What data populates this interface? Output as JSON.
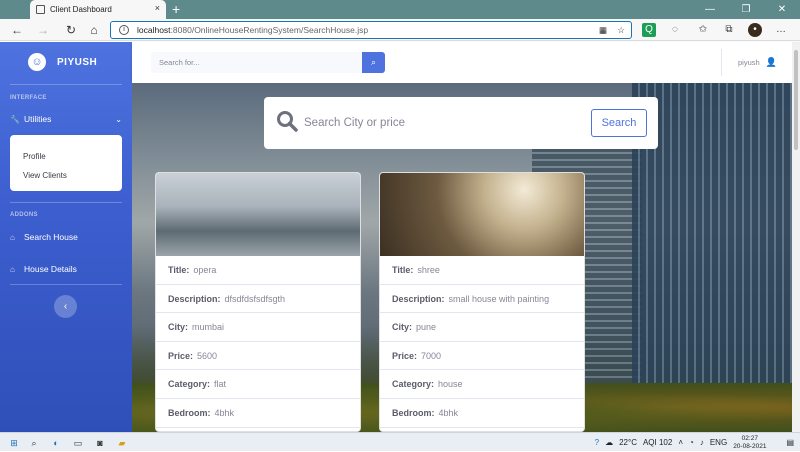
{
  "browser": {
    "tab_title": "Client Dashboard",
    "tab_close": "×",
    "new_tab": "+",
    "url_host": "localhost",
    "url_path": ":8080/OnlineHouseRentingSystem/SearchHouse.jsp",
    "win_minimize": "—",
    "win_restore": "❐",
    "win_close": "✕"
  },
  "sidebar": {
    "brand": "PIYUSH",
    "interface_heading": "INTERFACE",
    "utilities_label": "Utilities",
    "submenu": [
      "Profile",
      "View Clients"
    ],
    "addons_heading": "ADDONS",
    "search_house_label": "Search House",
    "house_details_label": "House Details",
    "toggle_glyph": "‹"
  },
  "topbar": {
    "search_placeholder": "Search for...",
    "user_name": "piyush"
  },
  "search": {
    "placeholder": "Search City or price",
    "button_label": "Search"
  },
  "cards": [
    {
      "title_label": "Title:",
      "title": "opera",
      "description_label": "Description:",
      "description": "dfsdfdsfsdfsgth",
      "city_label": "City:",
      "city": "mumbai",
      "price_label": "Price:",
      "price": "5600",
      "category_label": "Category:",
      "category": "flat",
      "bedroom_label": "Bedroom:",
      "bedroom": "4bhk"
    },
    {
      "title_label": "Title:",
      "title": "shree",
      "description_label": "Description:",
      "description": "small house with painting",
      "city_label": "City:",
      "city": "pune",
      "price_label": "Price:",
      "price": "7000",
      "category_label": "Category:",
      "category": "house",
      "bedroom_label": "Bedroom:",
      "bedroom": "4bhk"
    }
  ],
  "taskbar": {
    "temperature": "22°C",
    "aqi": "AQI 102",
    "language": "ENG",
    "time": "02:27",
    "date": "20-08-2021"
  },
  "colors": {
    "accent": "#4e73df",
    "sidebar_bottom": "#2f4fb8"
  },
  "icons": {
    "back": "back-arrow-icon",
    "forward": "forward-arrow-icon",
    "refresh": "refresh-icon",
    "search": "search-icon",
    "user": "user-icon",
    "wrench": "wrench-icon",
    "house": "house-icon"
  }
}
